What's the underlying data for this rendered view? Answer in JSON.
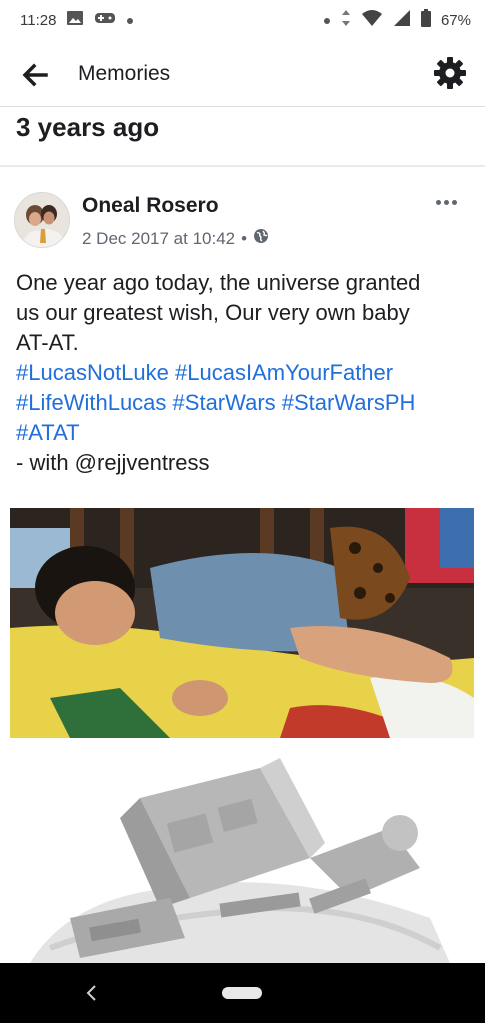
{
  "status_bar": {
    "time": "11:28",
    "battery": "67%",
    "icons": [
      "image-icon",
      "controller-icon",
      "dot-icon",
      "data-arrows-icon",
      "wifi-icon",
      "signal-icon",
      "battery-icon"
    ]
  },
  "app_bar": {
    "title": "Memories",
    "back_icon": "back-arrow-icon",
    "settings_icon": "gear-icon"
  },
  "section": {
    "heading": "3 years ago"
  },
  "post": {
    "author": "Oneal Rosero",
    "timestamp": "2 Dec 2017 at 10:42",
    "separator": "•",
    "privacy_icon": "globe-icon",
    "text_lines": [
      "One year ago today, the universe granted",
      "us our greatest wish, Our very own baby",
      "AT-AT."
    ],
    "hashtags": {
      "line1": [
        "#LucasNotLuke",
        "#LucasIAmYourFather"
      ],
      "line2": [
        "#LifeWithLucas",
        "#StarWars",
        "#StarWarsPH"
      ],
      "line3": [
        "#ATAT"
      ]
    },
    "with_text": "- with @rejjventress"
  },
  "colors": {
    "link": "#216fdb",
    "text": "#1c1e21",
    "meta": "#606770",
    "nav_bg": "#000000"
  }
}
